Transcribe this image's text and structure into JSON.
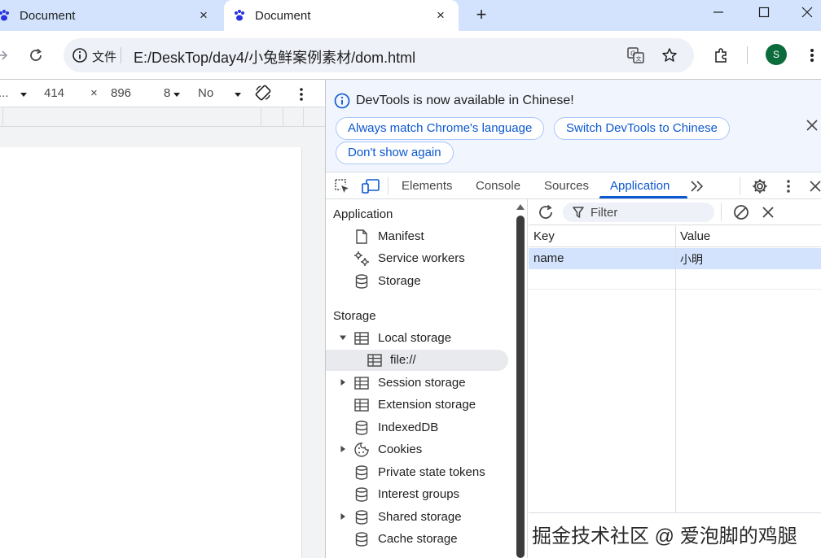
{
  "browser": {
    "tabs": [
      {
        "title": "Document"
      },
      {
        "title": "Document"
      }
    ],
    "tab_close_glyph": "×",
    "new_tab_glyph": "+",
    "omnibox": {
      "chip": "文件",
      "url": "E:/DeskTop/day4/小兔鲜案例素材/dom.html"
    },
    "profile_initial": "S"
  },
  "device_toolbar": {
    "device_suffix": "...",
    "width": "414",
    "times": "×",
    "height": "896",
    "dpr_partial": "8",
    "throttle": "No"
  },
  "infobar": {
    "message": "DevTools is now available in Chinese!",
    "buttons": {
      "match_language": "Always match Chrome's language",
      "switch_chinese": "Switch DevTools to Chinese",
      "dont_show": "Don't show again"
    }
  },
  "devtools_tabs": [
    "Elements",
    "Console",
    "Sources",
    "Application"
  ],
  "sidebar": {
    "application_heading": "Application",
    "application_items": [
      "Manifest",
      "Service workers",
      "Storage"
    ],
    "storage_heading": "Storage",
    "storage_items": {
      "local_storage": "Local storage",
      "local_origin": "file://",
      "session_storage": "Session storage",
      "extension_storage": "Extension storage",
      "indexeddb": "IndexedDB",
      "cookies": "Cookies",
      "private_state_tokens": "Private state tokens",
      "interest_groups": "Interest groups",
      "shared_storage": "Shared storage",
      "cache_storage": "Cache storage"
    }
  },
  "storage_panel": {
    "filter_placeholder": "Filter",
    "columns": {
      "key": "Key",
      "value": "Value"
    },
    "rows": [
      {
        "key": "name",
        "value": "小明"
      }
    ]
  },
  "watermark": "掘金技术社区 @ 爱泡脚的鸡腿",
  "colors": {
    "accent": "#0b57d0",
    "tabstrip": "#d3e3fd",
    "selected_row": "#d3e3fd",
    "avatar": "#0b6b3a"
  }
}
